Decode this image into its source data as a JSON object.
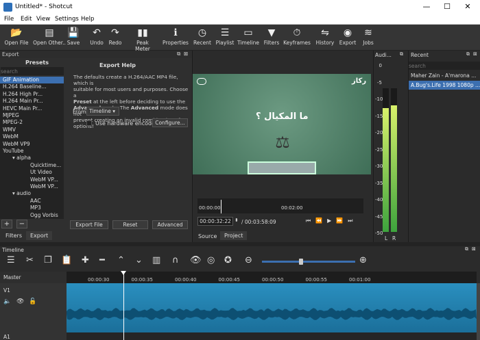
{
  "window": {
    "title": "Untitled* - Shotcut",
    "minimize": "—",
    "maximize": "☐",
    "close": "✕"
  },
  "menu": [
    "File",
    "Edit",
    "View",
    "Settings",
    "Help"
  ],
  "toolbar": [
    {
      "label": "Open File",
      "icon": "folder-open-icon",
      "glyph": "📂"
    },
    {
      "label": "Open Other..",
      "icon": "open-other-icon",
      "glyph": "▤"
    },
    {
      "label": "Save",
      "icon": "save-icon",
      "glyph": "💾"
    },
    {
      "label": "Undo",
      "icon": "undo-icon",
      "glyph": "↶"
    },
    {
      "label": "Redo",
      "icon": "redo-icon",
      "glyph": "↷"
    },
    {
      "label": "Peak Meter",
      "icon": "peak-meter-icon",
      "glyph": "▮▮"
    },
    {
      "label": "Properties",
      "icon": "properties-icon",
      "glyph": "ℹ"
    },
    {
      "label": "Recent",
      "icon": "recent-icon",
      "glyph": "◷"
    },
    {
      "label": "Playlist",
      "icon": "playlist-icon",
      "glyph": "☰"
    },
    {
      "label": "Timeline",
      "icon": "timeline-icon",
      "glyph": "▭"
    },
    {
      "label": "Filters",
      "icon": "filters-icon",
      "glyph": "▼"
    },
    {
      "label": "Keyframes",
      "icon": "keyframes-icon",
      "glyph": "⏱"
    },
    {
      "label": "History",
      "icon": "history-icon",
      "glyph": "⇋"
    },
    {
      "label": "Export",
      "icon": "export-icon",
      "glyph": "◉"
    },
    {
      "label": "Jobs",
      "icon": "jobs-icon",
      "glyph": "≋"
    }
  ],
  "export": {
    "panel_title": "Export",
    "search_placeholder": "search",
    "presets_header": "Presets",
    "help_title": "Export Help",
    "presets": [
      {
        "label": "GIF Animation",
        "indent": 1,
        "sel": true
      },
      {
        "label": "H.264 Baseline...",
        "indent": 1
      },
      {
        "label": "H.264 High Pr...",
        "indent": 1
      },
      {
        "label": "H.264 Main Pr...",
        "indent": 1
      },
      {
        "label": "HEVC Main Pr...",
        "indent": 1
      },
      {
        "label": "MJPEG",
        "indent": 1
      },
      {
        "label": "MPEG-2",
        "indent": 1
      },
      {
        "label": "WMV",
        "indent": 1
      },
      {
        "label": "WebM",
        "indent": 1
      },
      {
        "label": "WebM VP9",
        "indent": 1
      },
      {
        "label": "YouTube",
        "indent": 1
      },
      {
        "label": "▾ alpha",
        "indent": 0
      },
      {
        "label": "Quicktime...",
        "indent": 2
      },
      {
        "label": "Ut Video",
        "indent": 2
      },
      {
        "label": "WebM VP...",
        "indent": 2
      },
      {
        "label": "WebM VP...",
        "indent": 2
      },
      {
        "label": "▾ audio",
        "indent": 0
      },
      {
        "label": "AAC",
        "indent": 2
      },
      {
        "label": "MP3",
        "indent": 2
      },
      {
        "label": "Ogg Vorbis",
        "indent": 2
      }
    ],
    "help_line1": "The defaults create a H.264/AAC MP4 file, which is",
    "help_line2": "suitable for most users and purposes. Choose a",
    "help_line3_a": "Preset",
    "help_line3_b": " at the left before deciding to use the",
    "help_line4_a": "Advanced",
    "help_line4_b": " mode. The ",
    "help_line4_c": "Advanced",
    "help_line4_d": " mode does not",
    "help_line5": "prevent creating an invalid combination of options!",
    "from_label": "From",
    "from_value": "Timeline",
    "hw_label": "Use hardware encoder",
    "configure": "Configure...",
    "add": "+",
    "remove": "−",
    "export_file": "Export File",
    "reset": "Reset",
    "advanced": "Advanced",
    "tab_filters": "Filters",
    "tab_export": "Export"
  },
  "player": {
    "logo": "ركاز",
    "question": "ما المكيال ؟",
    "time_start": "00:00:00",
    "time_mid": "00:02:00",
    "current": "00:00:32:22",
    "duration": "/ 00:03:58:09",
    "tab_source": "Source",
    "tab_project": "Project"
  },
  "audio": {
    "title": "Audi...",
    "scale": [
      "0",
      "-5",
      "-10",
      "-15",
      "-20",
      "-25",
      "-30",
      "-35",
      "-40",
      "-45",
      "-50"
    ],
    "left": "L",
    "right": "R",
    "level_left": 0.86,
    "level_right": 0.88
  },
  "recent": {
    "title": "Recent",
    "search_placeholder": "search",
    "items": [
      {
        "label": "Maher Zain - A'marona ...",
        "sel": false
      },
      {
        "label": "A.Bug's.Life 1998 1080p ...",
        "sel": true
      }
    ]
  },
  "timeline": {
    "title": "Timeline",
    "master": "Master",
    "track_v1": "V1",
    "track_a1": "A1",
    "ticks": [
      "00:00:30",
      "00:00:35",
      "00:00:40",
      "00:00:45",
      "00:00:50",
      "00:00:55",
      "00:01:00"
    ],
    "zoom": 0.4,
    "tools": [
      {
        "name": "menu-icon",
        "g": "☰"
      },
      {
        "name": "cut-icon",
        "g": "✂"
      },
      {
        "name": "copy-icon",
        "g": "❐"
      },
      {
        "name": "paste-icon",
        "g": "📋"
      },
      {
        "name": "append-icon",
        "g": "✚"
      },
      {
        "name": "remove-icon",
        "g": "━"
      },
      {
        "name": "lift-icon",
        "g": "⌃"
      },
      {
        "name": "overwrite-icon",
        "g": "⌄"
      },
      {
        "name": "split-icon",
        "g": "▥"
      },
      {
        "name": "snap-icon",
        "g": "∩"
      },
      {
        "name": "scrub-icon",
        "g": "👁"
      },
      {
        "name": "ripple-icon",
        "g": "◎"
      },
      {
        "name": "ripple-all-icon",
        "g": "✪"
      },
      {
        "name": "zoom-out-icon",
        "g": "⊖"
      },
      {
        "name": "zoom-in-icon",
        "g": "⊕"
      }
    ]
  }
}
